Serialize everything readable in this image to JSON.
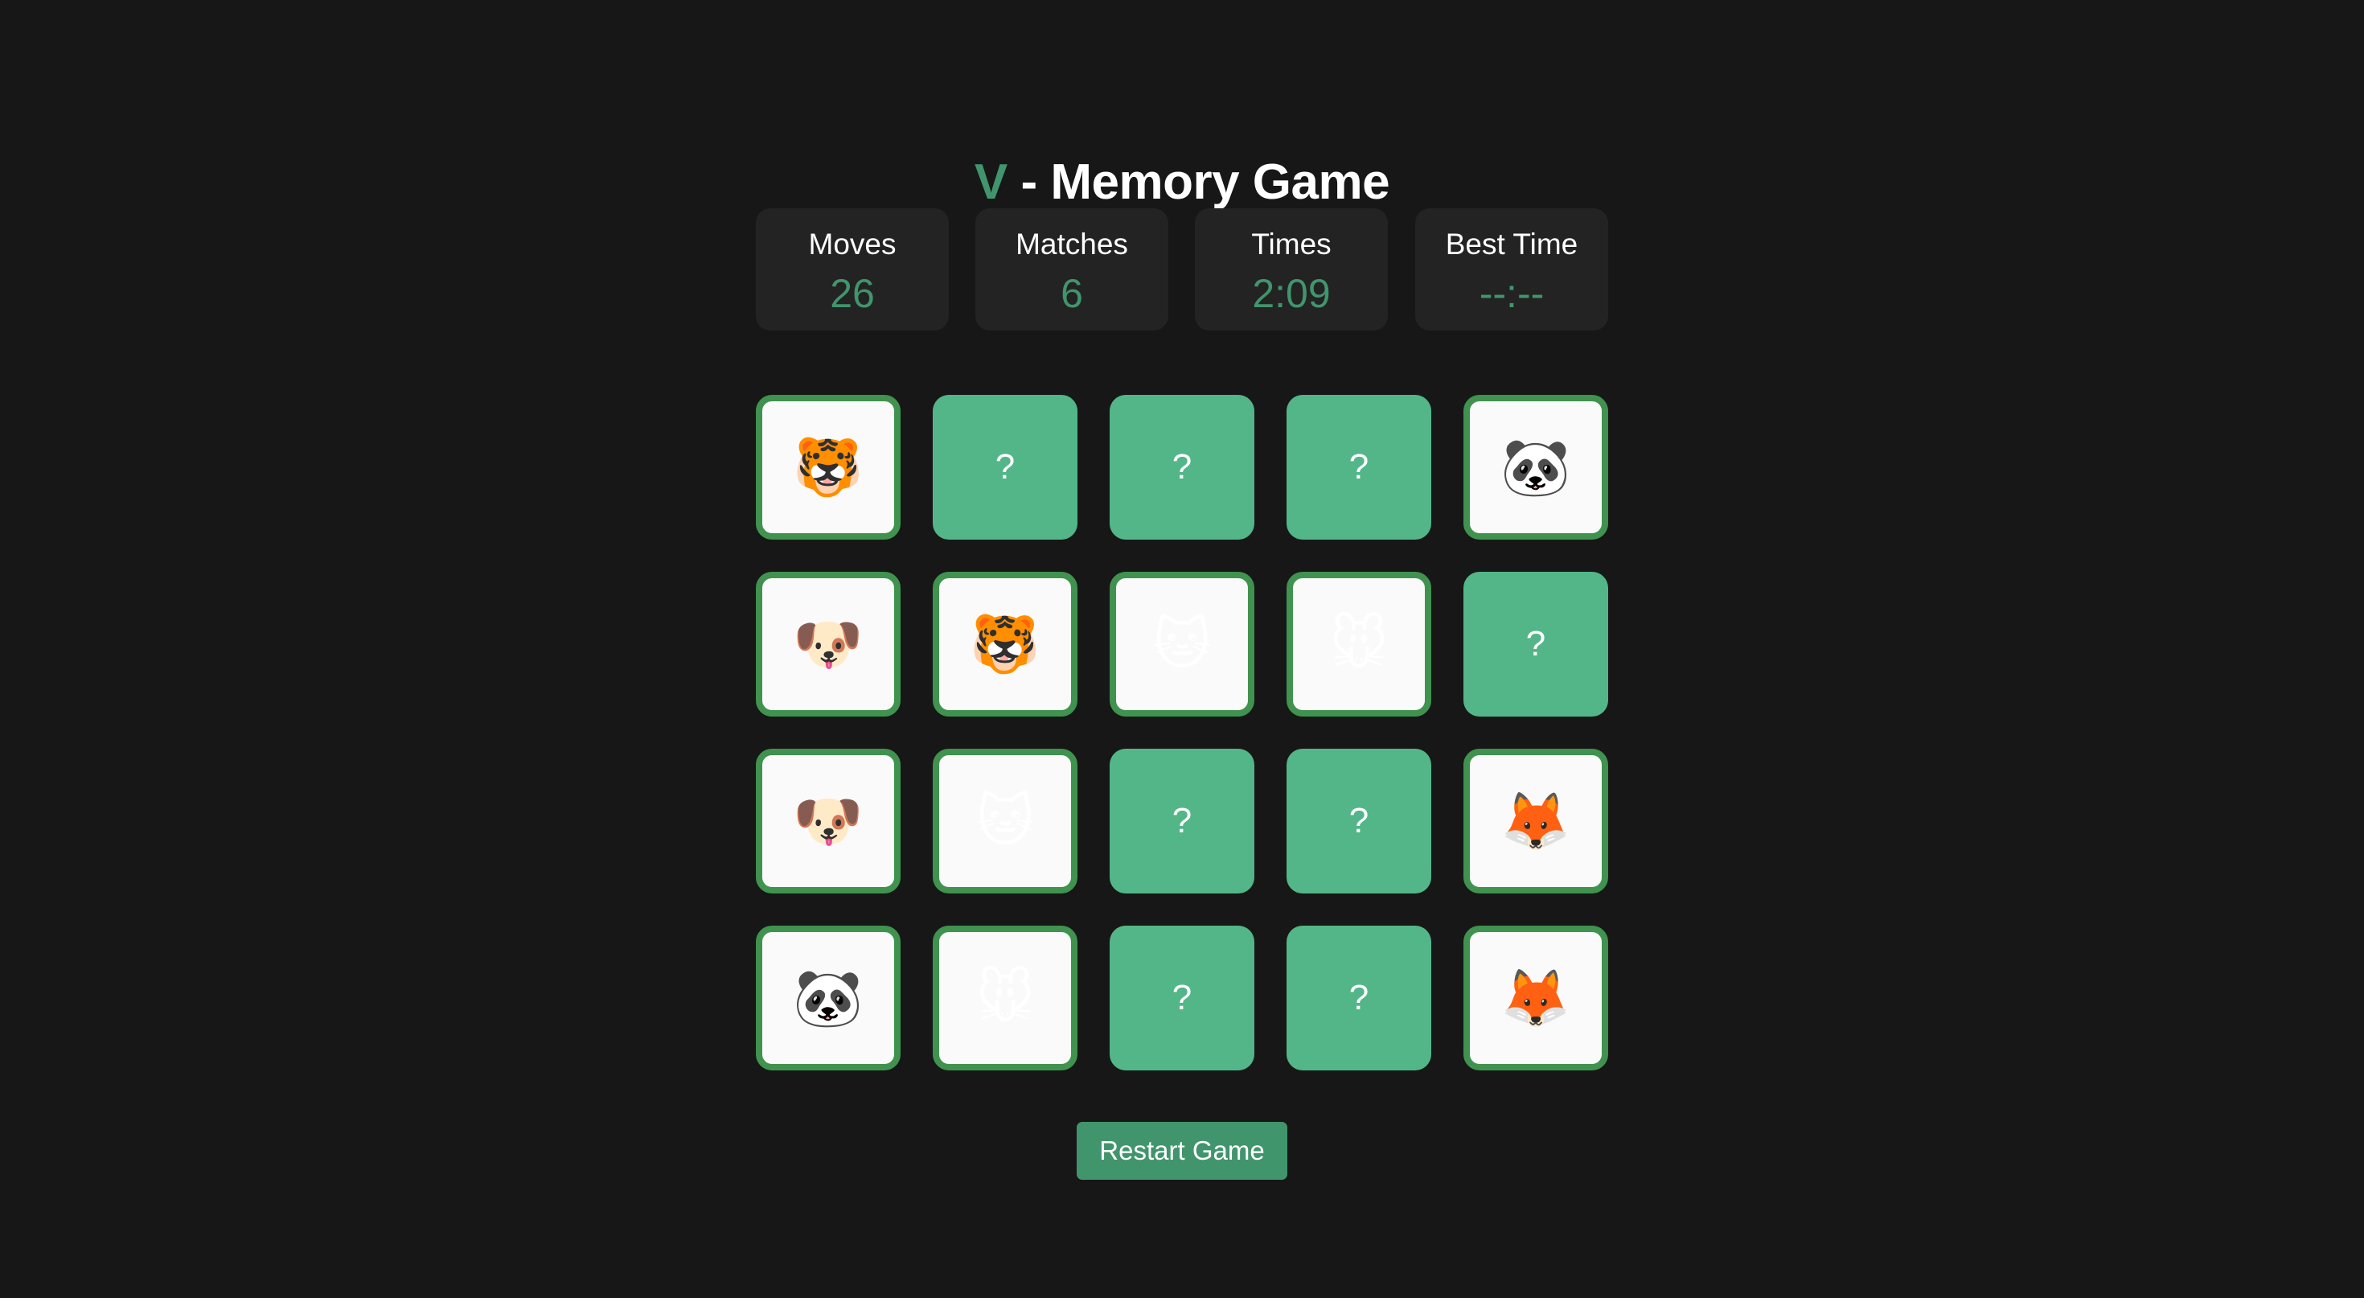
{
  "header": {
    "title_accent": "V",
    "title_rest": " - Memory Game"
  },
  "stats": [
    {
      "label": "Moves",
      "value": "26"
    },
    {
      "label": "Matches",
      "value": "6"
    },
    {
      "label": "Times",
      "value": "2:09"
    },
    {
      "label": "Best Time",
      "value": "--:--"
    }
  ],
  "board": {
    "columns": 5,
    "rows": 4,
    "hidden_symbol": "?",
    "cards": [
      {
        "state": "revealed",
        "symbol": "🐯",
        "icon": "tiger-face"
      },
      {
        "state": "hidden",
        "symbol": "?"
      },
      {
        "state": "hidden",
        "symbol": "?"
      },
      {
        "state": "hidden",
        "symbol": "?"
      },
      {
        "state": "revealed",
        "symbol": "🐼",
        "icon": "panda-face"
      },
      {
        "state": "revealed",
        "symbol": "🐶",
        "icon": "dog-face"
      },
      {
        "state": "revealed",
        "symbol": "🐯",
        "icon": "tiger-face"
      },
      {
        "state": "revealed",
        "symbol": "🐱",
        "icon": "cat-face"
      },
      {
        "state": "revealed",
        "symbol": "🐭",
        "icon": "mouse-face"
      },
      {
        "state": "hidden",
        "symbol": "?"
      },
      {
        "state": "revealed",
        "symbol": "🐶",
        "icon": "dog-face"
      },
      {
        "state": "revealed",
        "symbol": "🐱",
        "icon": "cat-face"
      },
      {
        "state": "hidden",
        "symbol": "?"
      },
      {
        "state": "hidden",
        "symbol": "?"
      },
      {
        "state": "revealed",
        "symbol": "🦊",
        "icon": "fox-face"
      },
      {
        "state": "revealed",
        "symbol": "🐼",
        "icon": "panda-face"
      },
      {
        "state": "revealed",
        "symbol": "🐭",
        "icon": "mouse-face"
      },
      {
        "state": "hidden",
        "symbol": "?"
      },
      {
        "state": "hidden",
        "symbol": "?"
      },
      {
        "state": "revealed",
        "symbol": "🦊",
        "icon": "fox-face"
      }
    ]
  },
  "controls": {
    "restart_label": "Restart Game"
  },
  "colors": {
    "background": "#171717",
    "panel": "#232323",
    "accent": "#41956c",
    "card_hidden": "#53b688",
    "card_revealed_border": "#40924f",
    "card_revealed_bg": "#fafafa"
  }
}
